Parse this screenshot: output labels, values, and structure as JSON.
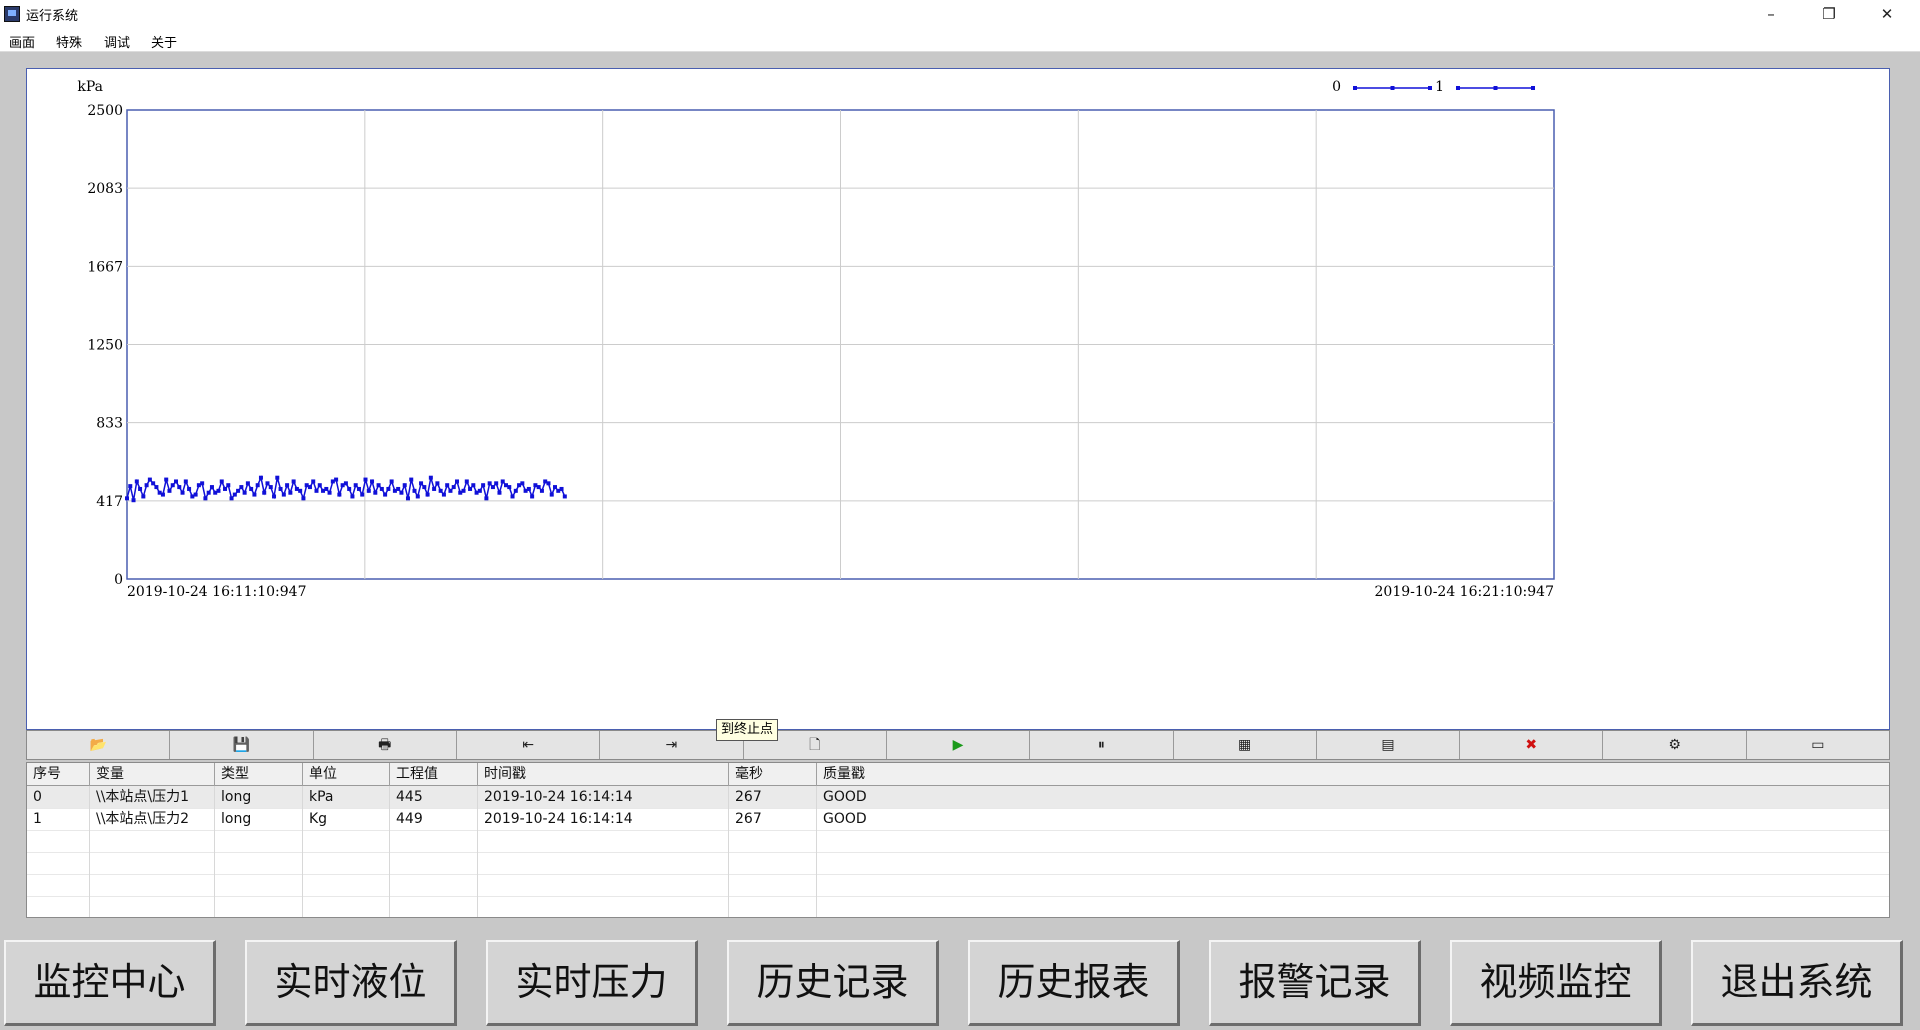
{
  "window": {
    "title": "运行系统",
    "minimize": "–",
    "restore": "❐",
    "close": "✕"
  },
  "menu": [
    "画面",
    "特殊",
    "调试",
    "关于"
  ],
  "chart_data": {
    "type": "line",
    "ylabel": "kPa",
    "ylim": [
      0,
      2500
    ],
    "yticks": [
      "2500",
      "2083",
      "1667",
      "1250",
      "833",
      "417",
      "0"
    ],
    "x_start": "2019-10-24  16:11:10:947",
    "x_end": "2019-10-24  16:21:10:947",
    "grid": true,
    "legend_position": "top-right",
    "series": [
      {
        "name": "0",
        "color": "#1010d8",
        "values": [
          430,
          495,
          420,
          520,
          480,
          440,
          500,
          530,
          510,
          490,
          460,
          450,
          530,
          470,
          500,
          520,
          490,
          460,
          520,
          480,
          440,
          450,
          500,
          510,
          430,
          460,
          490,
          460,
          470,
          520,
          480,
          500,
          430,
          450,
          470,
          490,
          460,
          510,
          480,
          450,
          500,
          540,
          460,
          510,
          490,
          440,
          540,
          480,
          450,
          500,
          460,
          520,
          480,
          470,
          430,
          500,
          490,
          520,
          470,
          500,
          470,
          480,
          460,
          520,
          530,
          450,
          500,
          510,
          480,
          440,
          500,
          480,
          450,
          530,
          470,
          520,
          460,
          500,
          480,
          450,
          480,
          520,
          470,
          480,
          460,
          500,
          430,
          530,
          470,
          440,
          510,
          490,
          450,
          540,
          480,
          510,
          470,
          450,
          500,
          470,
          490,
          520,
          460,
          470,
          520,
          480,
          500,
          460,
          470,
          500,
          430,
          510,
          490,
          510,
          460,
          520,
          500,
          490,
          440,
          470,
          500,
          510,
          470,
          480,
          440,
          500,
          490,
          470,
          520,
          510,
          450,
          490,
          470,
          480,
          440
        ]
      },
      {
        "name": "1",
        "color": "#1010d8",
        "values": []
      }
    ]
  },
  "toolbar": [
    {
      "icon": "open-folder-icon",
      "glyph": "📂"
    },
    {
      "icon": "save-icon",
      "glyph": "💾"
    },
    {
      "icon": "print-icon",
      "glyph": "🖶"
    },
    {
      "icon": "go-to-start-icon",
      "glyph": "⇤"
    },
    {
      "icon": "go-to-end-icon",
      "glyph": "⇥"
    },
    {
      "icon": "new-page-icon",
      "glyph": "🗋"
    },
    {
      "icon": "play-icon",
      "glyph": "▶"
    },
    {
      "icon": "pause-icon",
      "glyph": "⏸"
    },
    {
      "icon": "grid-icon",
      "glyph": "▦"
    },
    {
      "icon": "table-settings-icon",
      "glyph": "▤"
    },
    {
      "icon": "delete-icon",
      "glyph": "✖"
    },
    {
      "icon": "config-icon",
      "glyph": "⚙"
    },
    {
      "icon": "window-icon",
      "glyph": "▭"
    }
  ],
  "table": {
    "columns": [
      "序号",
      "变量",
      "类型",
      "单位",
      "工程值",
      "时间戳",
      "毫秒",
      "质量戳"
    ],
    "rows": [
      [
        "0",
        "\\\\本站点\\压力1",
        "long",
        "kPa",
        "445",
        "2019-10-24 16:14:14",
        "267",
        "GOOD"
      ],
      [
        "1",
        "\\\\本站点\\压力2",
        "long",
        "Kg",
        "449",
        "2019-10-24 16:14:14",
        "267",
        "GOOD"
      ]
    ]
  },
  "tooltip": "到终止点",
  "nav_buttons": [
    "监控中心",
    "实时液位",
    "实时压力",
    "历史记录",
    "历史报表",
    "报警记录",
    "视频监控",
    "退出系统"
  ]
}
